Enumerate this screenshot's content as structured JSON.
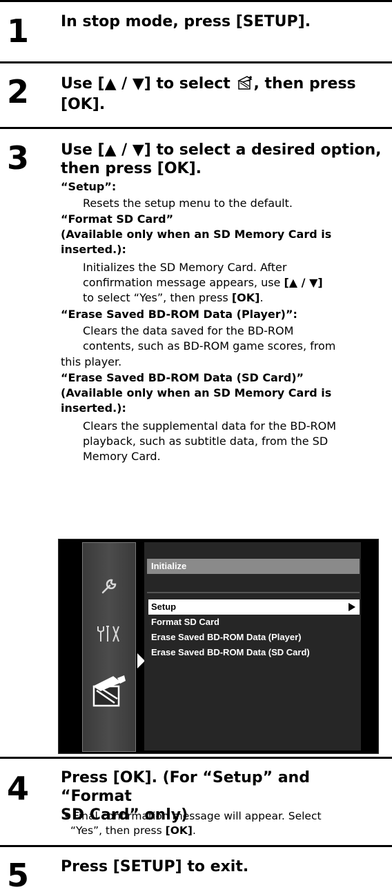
{
  "steps": [
    {
      "number": "1",
      "heading": "In stop mode, press [SETUP]."
    },
    {
      "number": "2",
      "heading_line1": "Use [▲ / ▼] to select",
      "heading_line1_end": ", then press",
      "heading_line2": "[OK]."
    },
    {
      "number": "3",
      "heading_line1": "Use [▲ / ▼] to select a desired option,",
      "heading_line2": "then press [OK].",
      "options": {
        "setup_label": "“Setup”:",
        "setup_desc": "Resets the setup menu to the default.",
        "format_label_1": "“Format SD Card”",
        "format_label_2": "(Available only when an SD Memory Card is",
        "format_label_3": "inserted.):",
        "format_desc_1": "Initializes the SD Memory Card. After",
        "format_desc_2a": "confirmation message appears, use",
        "format_desc_2b": "[▲ / ▼]",
        "format_desc_3a": "to select “Yes”, then press",
        "format_desc_3b": "[OK]",
        "format_desc_3c": ".",
        "erase_player_label": "“Erase Saved BD-ROM Data (Player)”:",
        "erase_player_desc_1": "Clears the data saved for the BD-ROM",
        "erase_player_desc_2": "contents, such as BD-ROM game scores, from",
        "erase_player_desc_3": "this player.",
        "erase_sd_label_1": "“Erase Saved BD-ROM Data (SD Card)”",
        "erase_sd_label_2": "(Available only when an SD Memory Card is",
        "erase_sd_label_3": "inserted.):",
        "erase_sd_desc_1": "Clears the supplemental data for the BD-ROM",
        "erase_sd_desc_2": "playback, such as subtitle data, from the SD",
        "erase_sd_desc_3": "Memory Card."
      }
    },
    {
      "number": "4",
      "heading_line1": "Press [OK]. (For “Setup” and “Format",
      "heading_line2": "SD Card” only)",
      "bullet_1": "• Final confirmation message will appear. Select",
      "bullet_2a": "“Yes”, then press",
      "bullet_2b": "[OK]",
      "bullet_2c": "."
    },
    {
      "number": "5",
      "heading": "Press [SETUP] to exit."
    }
  ],
  "screen": {
    "panel_title": "Initialize",
    "menu_options": [
      "Setup",
      "Format SD Card",
      "Erase Saved BD-ROM Data (Player)",
      "Erase Saved BD-ROM Data (SD Card)"
    ],
    "side_icons": [
      "wrench-icon",
      "tools-icon",
      "clapperboard-icon"
    ]
  }
}
